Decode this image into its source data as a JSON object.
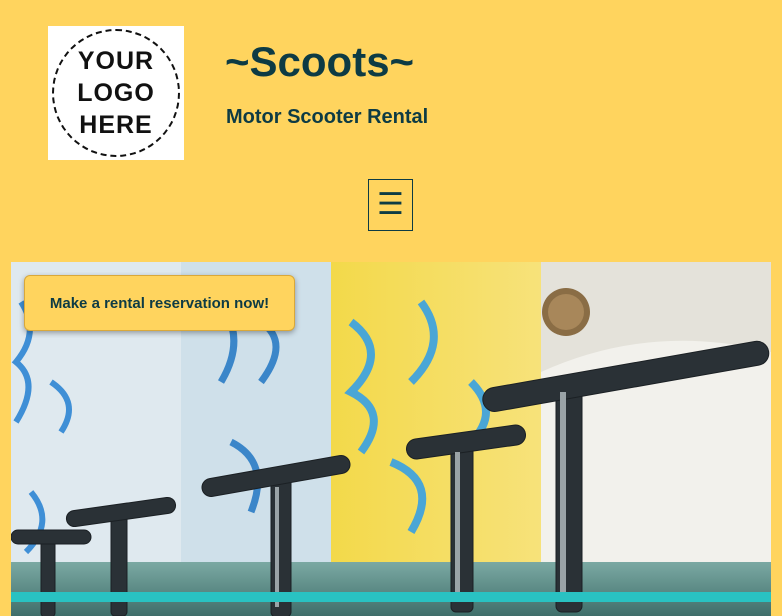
{
  "logo": {
    "lines": [
      "YOUR",
      "LOGO",
      "HERE"
    ]
  },
  "site": {
    "title": "~Scoots~",
    "tagline": "Motor Scooter Rental"
  },
  "menu": {
    "icon_glyph": "☰",
    "icon": "hamburger-menu-icon"
  },
  "cta": {
    "label": "Make a rental reservation now!"
  },
  "colors": {
    "background": "#ffd45e",
    "text": "#0d3b44",
    "logo_bg": "#ffffff"
  }
}
